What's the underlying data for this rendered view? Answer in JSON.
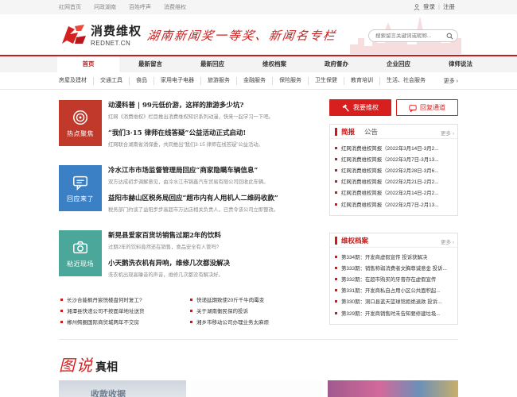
{
  "topbar": {
    "links": [
      "红网首页",
      "问政湖南",
      "百姓呼声",
      "消费维权"
    ],
    "login": "登录",
    "register": "注册",
    "sep": "|"
  },
  "header": {
    "logo_cn": "消费维权",
    "logo_en": "REDNET.CN",
    "slogan": "湖南新闻奖一等奖、新闻名专栏",
    "search_placeholder": "搜索留言关键词或昵称..."
  },
  "nav": {
    "items": [
      "首页",
      "最新留言",
      "最新回应",
      "维权档案",
      "政府督办",
      "企业回应",
      "律师说法"
    ],
    "active_index": 0
  },
  "subnav": {
    "items": [
      "房屋及建材",
      "交通工具",
      "食品",
      "家用电子电器",
      "旅游服务",
      "金融服务",
      "保险服务",
      "卫生保健",
      "教育培训",
      "生活、社会服务"
    ],
    "more": "更多"
  },
  "blocks": [
    {
      "tile_label": "热点聚焦",
      "tile_color": "#c0392b",
      "items": [
        {
          "title": "动漫科普 | 99元低价游，这样的旅游多少坑?",
          "desc": "红网《消费维权》栏目推出消费维权知识系列动漫，快来一起学习一下吧。"
        },
        {
          "title": "“我们3·15 律师在线答疑”公益活动正式启动!",
          "desc": "红网联合湖南省消保委，共同推出“我们3·15 律师在线答疑”公益活动。"
        }
      ]
    },
    {
      "tile_label": "回应来了",
      "tile_color": "#3b7fc4",
      "items": [
        {
          "title": "冷水江市市场监督管理局回应“商家隐瞒车辆信息”",
          "desc": "双方达成初步调解意见，由冷水江市锦鑫汽车贸易有限公司回收此车辆。"
        },
        {
          "title": "益阳市赫山区税务局回应“超市内有人用机人二维码收款”",
          "desc": "税务部门约谈了益阳步步高超市万达店相关负责人，已责令该公司立即整改。"
        }
      ]
    },
    {
      "tile_label": "粘近现场",
      "tile_color": "#4aa79a",
      "items": [
        {
          "title": "新晃县爱家百货坊销售过期2年的饮料",
          "desc": "过期2年的饮料竟然还在销售，食品安全有人管吗?"
        },
        {
          "title": "小天鹅洗衣机有异响，维修几次都没解决",
          "desc": "洗衣机出现高噪音的声音，维修几次都没有解决好。"
        }
      ]
    }
  ],
  "bottom_list": [
    [
      "长沙合能枫丹宸悦楼盘何时复工?",
      "快递延期致使20斤千牛肉霉变"
    ],
    [
      "湘潭县快递公司不按面单地址送货",
      "关于湖南衡民保的投诉"
    ],
    [
      "郴州鳄圈国际商贸城两年不交房",
      "湘乡市移动公司办理业务太麻烦"
    ]
  ],
  "sidebar": {
    "btn_complain": "我要维权",
    "btn_reply": "回复通道",
    "panel1": {
      "title": "简报",
      "title2": "公告",
      "more": "更多",
      "items": [
        "红网消费维权简报（2022年3月14日-3月2...",
        "红网消费维权简报（2022年3月7日-3月13...",
        "红网消费维权简报（2022年2月28日-3月6...",
        "红网消费维权简报（2022年2月21日-2月2...",
        "红网消费维权简报（2022年2月14日-2月2...",
        "红网消费维权简报（2022年2月7日-2月13..."
      ]
    },
    "panel2": {
      "title": "维权档案",
      "more": "更多",
      "items": [
        "第334期：开发商虚假宣传 投诉获解决",
        "第333期：销售称弱消费者文胸尊诚意金 投诉...",
        "第332期：在超市购买的牙膏存在虚假宣传",
        "第331期：开发商私自占用小区公共面积起...",
        "第330期：洞口县蓝天篮球馆拒绝退款 投诉...",
        "第329期：开发商销售时未告知要修建垃圾..."
      ]
    }
  },
  "photo_section": {
    "title_a": "图说",
    "title_b": "真相",
    "photo1_caption": "收款收据"
  },
  "colors": {
    "brand_red": "#c81a1a",
    "button_red": "#d71f1f"
  }
}
